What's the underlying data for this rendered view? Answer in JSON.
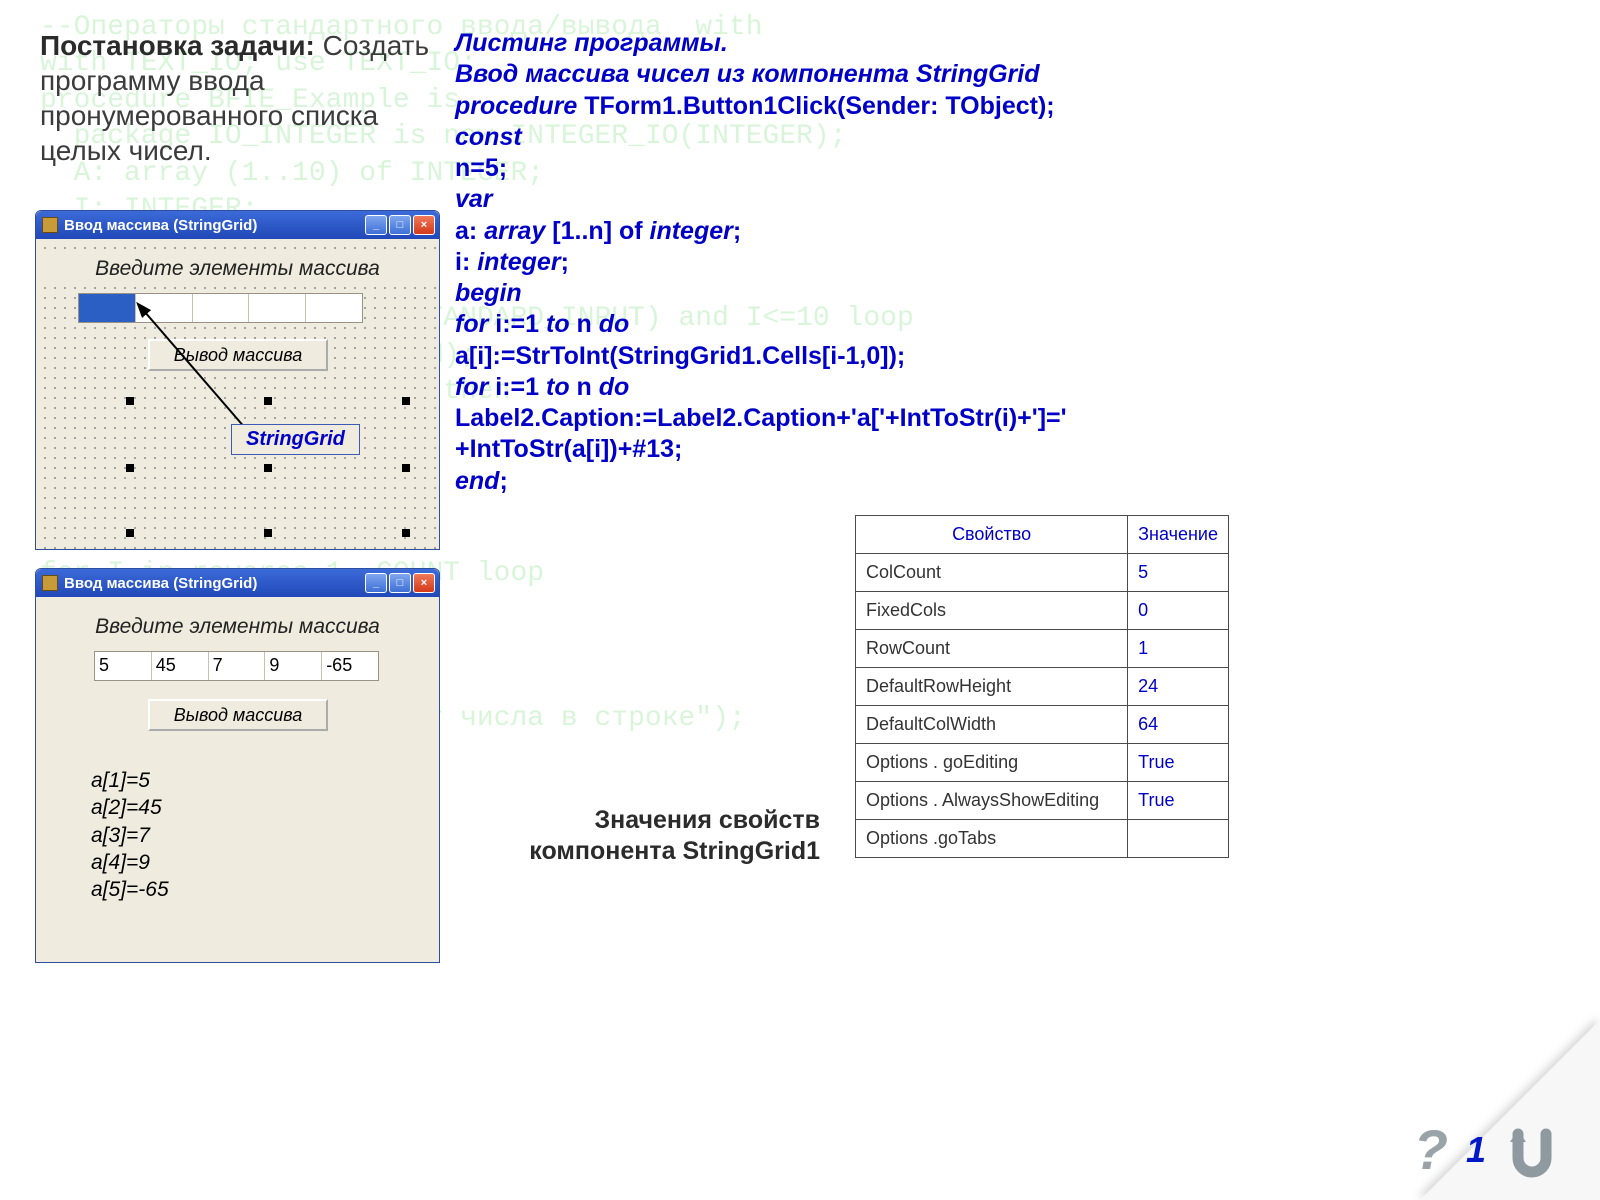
{
  "bg_code": "--Операторы стандартного ввода/вывода  with\nwith TEXT_IO; use TEXT_IO;\nprocedure BFIE_Example is\n  package IO_INTEGER is new INTEGER_IO(INTEGER);\n  A: array (1..10) of INTEGER;\n  I: INTEGER;\n.\n;\nwhile not END_OF_FILE(STANDARD_INPUT) and I<=10 loop\n  IO_INTEGER.GET(CUR_NUM);\n  if (CUR_NUM mod 2)/=0 then\n    COUNT:=COUNT+1;\n    A(COUNT):=CUR_NUM;\n\n\nfor I in reverse 1..COUNT loop\n  PUT(A(I));\n\nothers =>\nPut(\"Неправильный формат числа в строке\");",
  "task": {
    "title": "Постановка задачи:",
    "body": "Создать программу ввода пронумерованного списка целых чисел."
  },
  "listing": {
    "l1": "Листинг программы.",
    "l2": "Ввод массива чисел из компонента StringGrid",
    "l3a": "procedure",
    "l3b": " TForm1.Button1Click(Sender: TObject);",
    "l4": "const",
    "l5": "n=5;",
    "l6": "var",
    "l7a": "a: ",
    "l7b": "array",
    "l7c": " [1..n] of ",
    "l7d": "integer",
    "l7e": ";",
    "l8a": "i: ",
    "l8b": "integer",
    "l8c": ";",
    "l9": "begin",
    "l10a": "for",
    "l10b": " i:=1 ",
    "l10c": "to",
    "l10d": " n ",
    "l10e": "do",
    "l11": "a[i]:=StrToInt(StringGrid1.Cells[i-1,0]);",
    "l12a": "for",
    "l12b": " i:=1 ",
    "l12c": "to",
    "l12d": " n ",
    "l12e": "do",
    "l13": "Label2.Caption:=Label2.Caption+'a['+IntToStr(i)+']='",
    "l14": "+IntToStr(a[i])+#13;",
    "l15a": "end",
    "l15b": ";"
  },
  "win": {
    "title": "Ввод массива (StringGrid)",
    "label_input": "Введите элементы массива",
    "btn_output": "Вывод массива",
    "sg_label": "StringGrid"
  },
  "grid_values": [
    "5",
    "45",
    "7",
    "9",
    "-65"
  ],
  "output_lines": [
    "a[1]=5",
    "a[2]=45",
    "a[3]=7",
    "a[4]=9",
    "a[5]=-65"
  ],
  "props_caption": "Значения свойств компонента StringGrid1",
  "props_headers": {
    "prop": "Свойство",
    "val": "Значение"
  },
  "props": [
    {
      "prop": "ColCount",
      "val": "5"
    },
    {
      "prop": "FixedCols",
      "val": "0"
    },
    {
      "prop": "RowCount",
      "val": "1"
    },
    {
      "prop": "DefaultRowHeight",
      "val": "24"
    },
    {
      "prop": "DefaultColWidth",
      "val": "64"
    },
    {
      "prop": "Options . goEditing",
      "val": "True"
    },
    {
      "prop": "Options . AlwaysShowEditing",
      "val": "True"
    },
    {
      "prop": "Options .goTabs",
      "val": ""
    }
  ],
  "footer": {
    "page": "1",
    "q": "?"
  }
}
